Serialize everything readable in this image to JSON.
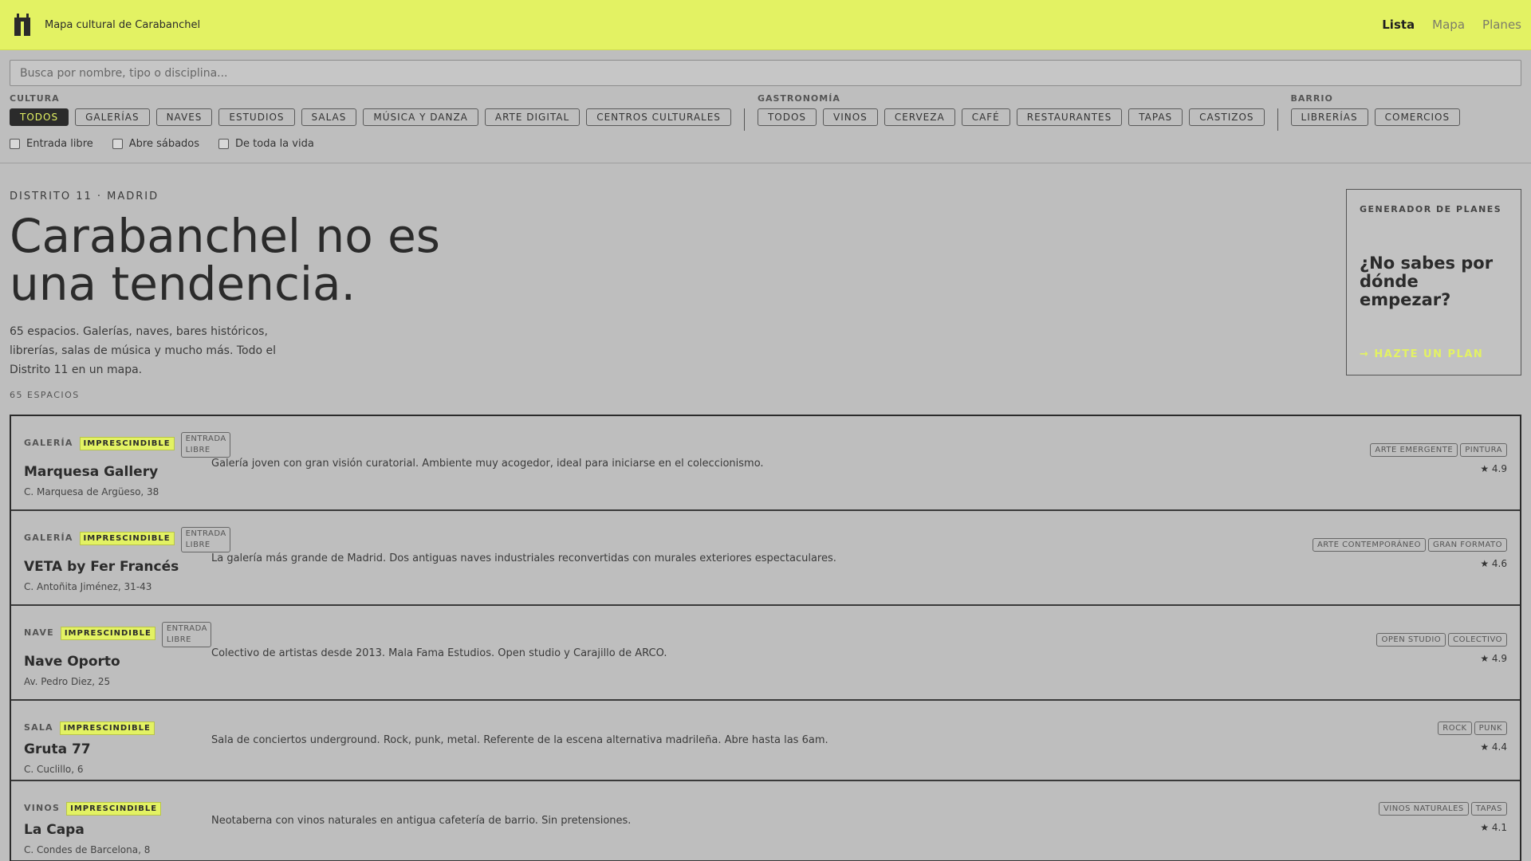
{
  "header": {
    "title": "Mapa cultural de Carabanchel",
    "nav": [
      "Lista",
      "Mapa",
      "Planes"
    ]
  },
  "search": {
    "placeholder": "Busca por nombre, tipo o disciplina..."
  },
  "filters": {
    "cultura": {
      "label": "CULTURA",
      "chips": [
        "TODOS",
        "GALERÍAS",
        "NAVES",
        "ESTUDIOS",
        "SALAS",
        "MÚSICA Y DANZA",
        "ARTE DIGITAL",
        "CENTROS CULTURALES"
      ]
    },
    "gastronomia": {
      "label": "GASTRONOMÍA",
      "chips": [
        "TODOS",
        "VINOS",
        "CERVEZA",
        "CAFÉ",
        "RESTAURANTES",
        "TAPAS",
        "CASTIZOS"
      ]
    },
    "barrio": {
      "label": "BARRIO",
      "chips": [
        "LIBRERÍAS",
        "COMERCIOS"
      ]
    },
    "checks": [
      "Entrada libre",
      "Abre sábados",
      "De toda la vida"
    ]
  },
  "hero": {
    "eyebrow": "DISTRITO 11 · MADRID",
    "headline": "Carabanchel no es una tendencia.",
    "sub": "65 espacios. Galerías, naves, bares históricos, librerías, salas de música y mucho más. Todo el Distrito 11 en un mapa.",
    "count": "65 ESPACIOS"
  },
  "plan": {
    "eyebrow": "GENERADOR DE PLANES",
    "title": "¿No sabes por dónde empezar?",
    "cta": "→ HAZTE UN PLAN"
  },
  "badges": {
    "must": "IMPRESCINDIBLE",
    "free": "ENTRADA LIBRE"
  },
  "places": [
    {
      "type": "GALERÍA",
      "name": "Marquesa Gallery",
      "address": "C. Marquesa de Argüeso, 38",
      "desc": "Galería joven con gran visión curatorial. Ambiente muy acogedor, ideal para iniciarse en el coleccionismo.",
      "tags": [
        "ARTE EMERGENTE",
        "PINTURA"
      ],
      "rating": "★ 4.9"
    },
    {
      "type": "GALERÍA",
      "name": "VETA by Fer Francés",
      "address": "C. Antoñita Jiménez, 31-43",
      "desc": "La galería más grande de Madrid. Dos antiguas naves industriales reconvertidas con murales exteriores espectaculares.",
      "tags": [
        "ARTE CONTEMPORÁNEO",
        "GRAN FORMATO"
      ],
      "rating": "★ 4.6"
    },
    {
      "type": "NAVE",
      "name": "Nave Oporto",
      "address": "Av. Pedro Diez, 25",
      "desc": "Colectivo de artistas desde 2013. Mala Fama Estudios. Open studio y Carajillo de ARCO.",
      "tags": [
        "OPEN STUDIO",
        "COLECTIVO"
      ],
      "rating": "★ 4.9"
    },
    {
      "type": "SALA",
      "name": "Gruta 77",
      "address": "C. Cuclillo, 6",
      "desc": "Sala de conciertos underground. Rock, punk, metal. Referente de la escena alternativa madrileña. Abre hasta las 6am.",
      "tags": [
        "ROCK",
        "PUNK"
      ],
      "rating": "★ 4.4"
    },
    {
      "type": "VINOS",
      "name": "La Capa",
      "address": "C. Condes de Barcelona, 8",
      "desc": "Neotaberna con vinos naturales en antigua cafetería de barrio. Sin pretensiones.",
      "tags": [
        "VINOS NATURALES",
        "TAPAS"
      ],
      "rating": "★ 4.1"
    }
  ]
}
